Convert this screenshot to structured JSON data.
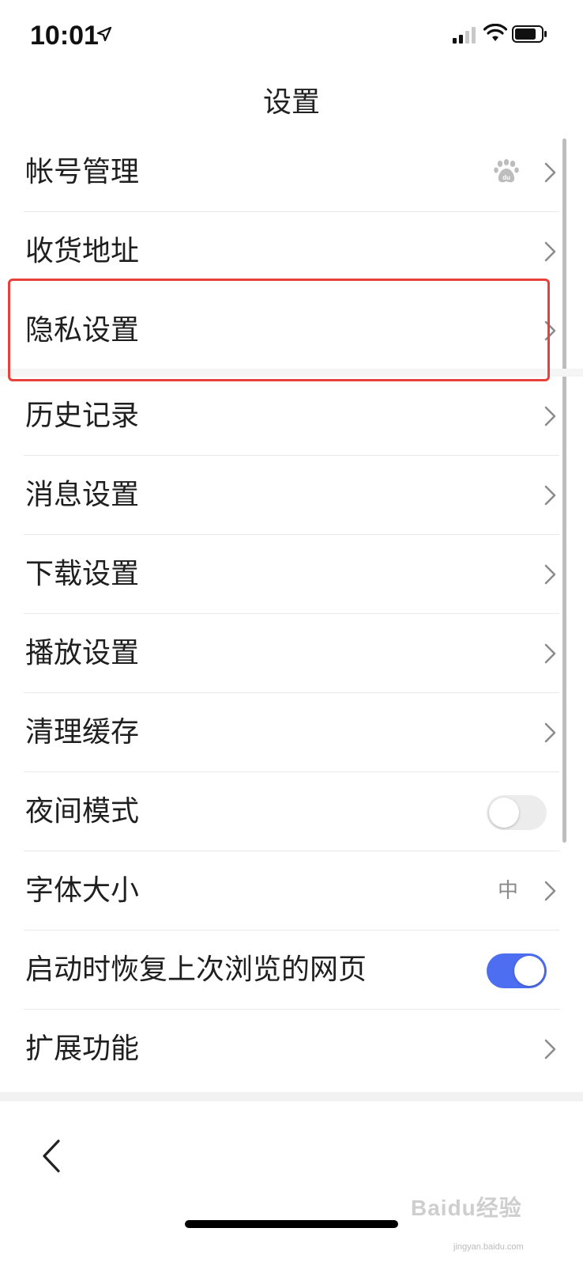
{
  "status_bar": {
    "time": "10:01",
    "icons": [
      "location-arrow-icon",
      "cellular-signal-icon",
      "wifi-icon",
      "battery-icon"
    ]
  },
  "nav": {
    "title": "设置"
  },
  "settings": {
    "account": {
      "label": "帐号管理",
      "icon": "baidu-paw-icon"
    },
    "address": {
      "label": "收货地址"
    },
    "privacy": {
      "label": "隐私设置",
      "highlighted": true
    },
    "history": {
      "label": "历史记录"
    },
    "message": {
      "label": "消息设置"
    },
    "download": {
      "label": "下载设置"
    },
    "playback": {
      "label": "播放设置"
    },
    "cache": {
      "label": "清理缓存"
    },
    "night_mode": {
      "label": "夜间模式",
      "enabled": false
    },
    "font_size": {
      "label": "字体大小",
      "value": "中"
    },
    "restore_pages": {
      "label": "启动时恢复上次浏览的网页",
      "enabled": true
    },
    "extensions": {
      "label": "扩展功能"
    }
  },
  "colors": {
    "toggle_on": "#4e6ef2",
    "toggle_off": "#ececec",
    "highlight_border": "#e8403a"
  },
  "watermark": {
    "text": "Baidu经验",
    "sub": "jingyan.baidu.com"
  },
  "bottom_bar": {
    "back_icon": "back-chevron-icon"
  }
}
